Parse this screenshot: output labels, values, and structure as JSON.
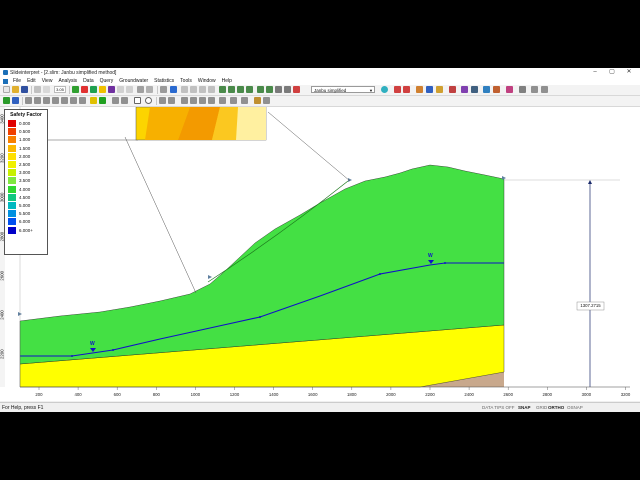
{
  "window": {
    "title": "Slideinterpret - [2.slim: Janbu simplified method]",
    "controls": {
      "minimize": "–",
      "maximize": "▢",
      "close": "✕"
    }
  },
  "menu": [
    "File",
    "Edit",
    "View",
    "Analysis",
    "Data",
    "Query",
    "Groundwater",
    "Statistics",
    "Tools",
    "Window",
    "Help"
  ],
  "toolbar": {
    "zoom_value": "3.05",
    "method_dropdown": "Janbu simplified"
  },
  "legend": {
    "title": "Safety Factor",
    "entries": [
      {
        "value": "0.000",
        "color": "#e00000"
      },
      {
        "value": "0.500",
        "color": "#f04000"
      },
      {
        "value": "1.000",
        "color": "#f88000"
      },
      {
        "value": "1.500",
        "color": "#fcb800"
      },
      {
        "value": "2.000",
        "color": "#ffe000"
      },
      {
        "value": "2.500",
        "color": "#f0f000"
      },
      {
        "value": "3.000",
        "color": "#c8f000"
      },
      {
        "value": "3.500",
        "color": "#80e840"
      },
      {
        "value": "4.000",
        "color": "#30d830"
      },
      {
        "value": "4.500",
        "color": "#10c880"
      },
      {
        "value": "5.000",
        "color": "#00b8c0"
      },
      {
        "value": "5.500",
        "color": "#0090e0"
      },
      {
        "value": "6.000",
        "color": "#0050f0"
      },
      {
        "value": "6.000+",
        "color": "#0000c8"
      }
    ]
  },
  "axes": {
    "x_ticks": [
      "200",
      "400",
      "600",
      "800",
      "1000",
      "1200",
      "1400",
      "1600",
      "1800",
      "2000",
      "2200",
      "2400",
      "2600",
      "2800",
      "3000",
      "3200"
    ],
    "y_ticks": [
      "3400",
      "3200",
      "3000",
      "2800",
      "2600",
      "2400",
      "2200"
    ]
  },
  "dimension_label": "1307.2715",
  "water_marker": "W",
  "colors": {
    "soil_upper": "#44e044",
    "soil_lower": "#ffff00",
    "bedrock": "#c8a88c",
    "water_table": "#1010c8"
  },
  "status": {
    "help": "For Help, press F1",
    "items": [
      {
        "label": "DATA TIPS OFF",
        "on": false
      },
      {
        "label": "SNAP",
        "on": true
      },
      {
        "label": "GRID",
        "on": false
      },
      {
        "label": "ORTHO",
        "on": true
      },
      {
        "label": "OSNAP",
        "on": false
      }
    ]
  }
}
